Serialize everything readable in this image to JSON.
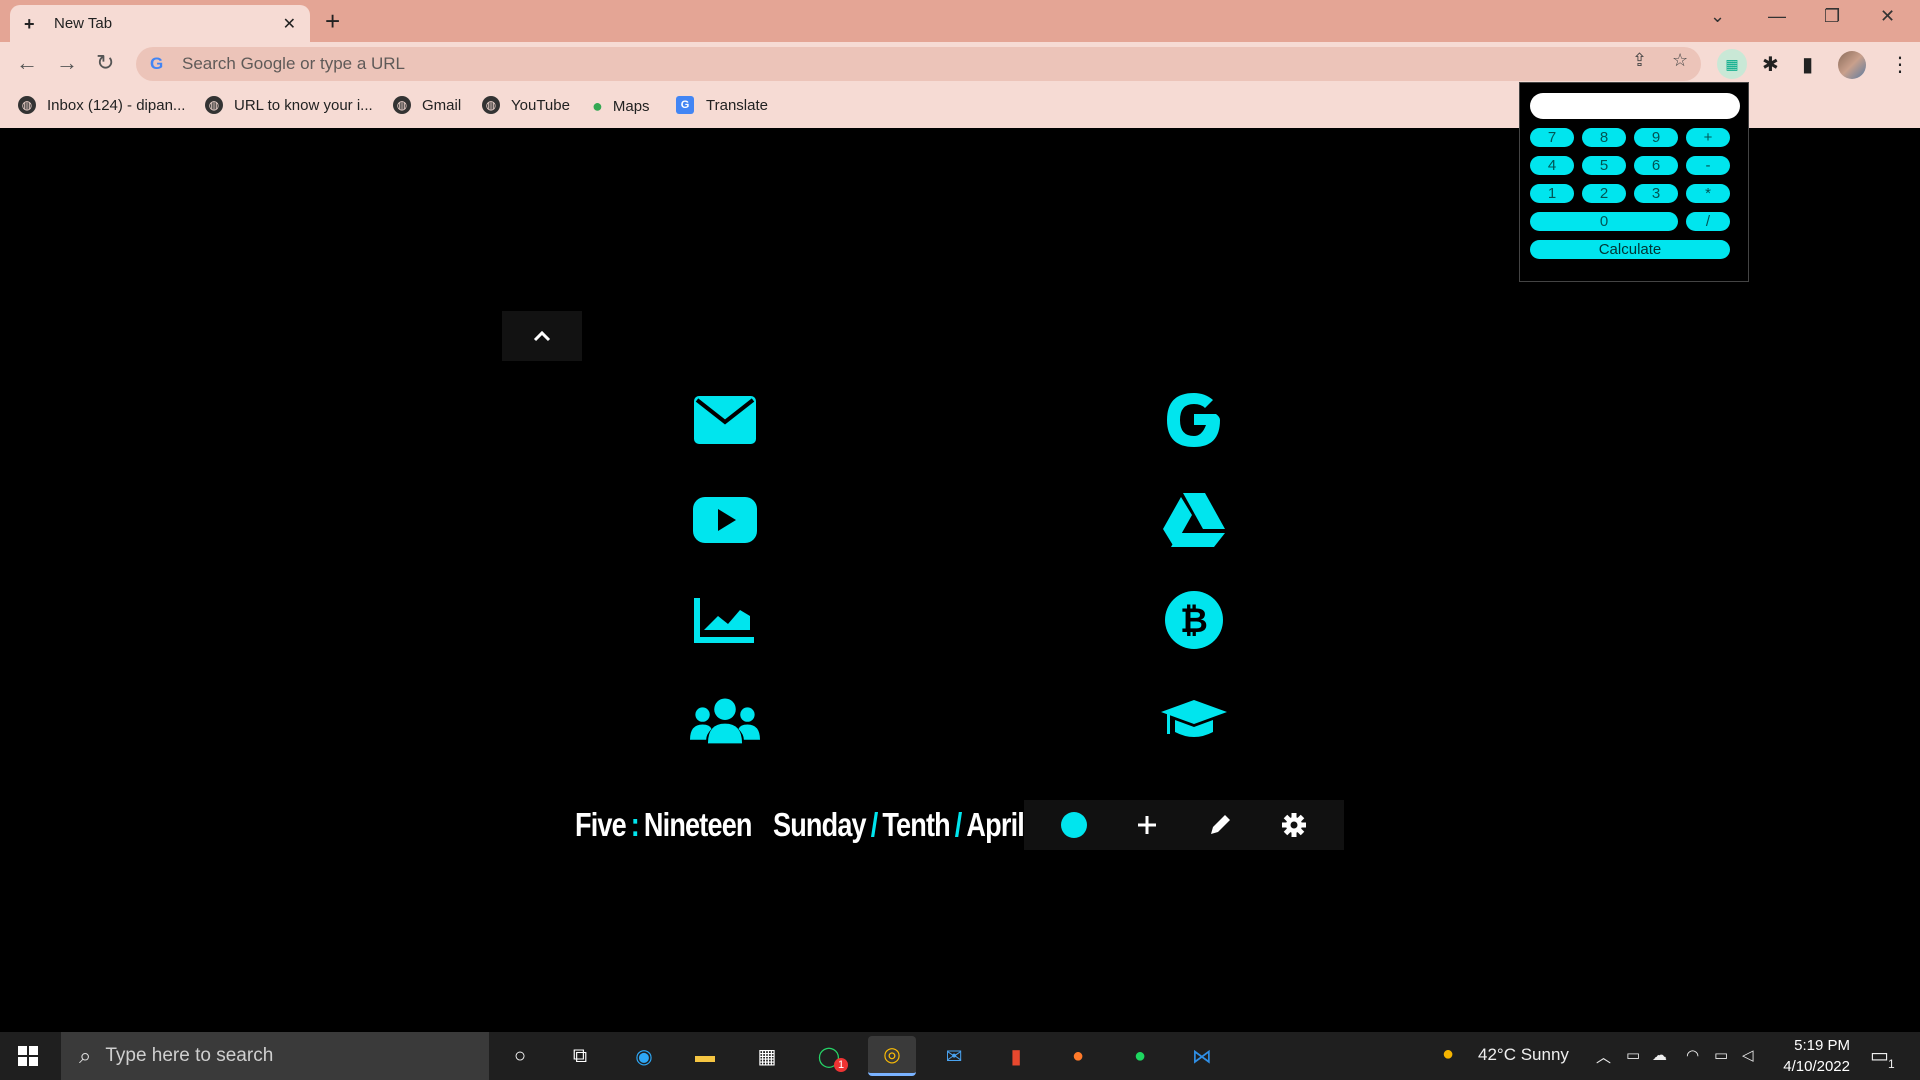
{
  "browser": {
    "tab_title": "New Tab",
    "omnibox_placeholder": "Search Google or type a URL",
    "bookmarks": [
      {
        "label": "Inbox (124) - dipan...",
        "icon": "globe-icon"
      },
      {
        "label": "URL to know your i...",
        "icon": "globe-icon"
      },
      {
        "label": "Gmail",
        "icon": "globe-icon"
      },
      {
        "label": "YouTube",
        "icon": "globe-icon"
      },
      {
        "label": "Maps",
        "icon": "maps-pin-icon"
      },
      {
        "label": "Translate",
        "icon": "translate-icon"
      }
    ],
    "theme_colors": {
      "tabstrip": "#e4a595",
      "toolbar": "#f6dbd4"
    }
  },
  "calculator": {
    "display_value": "",
    "rows": [
      [
        "7",
        "8",
        "9",
        "+"
      ],
      [
        "4",
        "5",
        "6",
        "-"
      ],
      [
        "1",
        "2",
        "3",
        "*"
      ],
      [
        "0",
        "/"
      ]
    ],
    "calculate_label": "Calculate",
    "accent": "#00e5ee"
  },
  "page": {
    "accent": "#00e5ee",
    "shortcuts_left": [
      "envelope-icon",
      "youtube-icon",
      "chart-line-icon",
      "users-icon"
    ],
    "shortcuts_right": [
      "google-icon",
      "google-drive-icon",
      "bitcoin-icon",
      "graduation-cap-icon"
    ],
    "clock": {
      "hours": "Five",
      "time_sep": ":",
      "minutes": "Nineteen",
      "day": "Sunday",
      "date_sep": "/",
      "date": "Tenth",
      "month": "April"
    },
    "controls": [
      "theme-dot-icon",
      "plus-icon",
      "pencil-icon",
      "gear-icon"
    ]
  },
  "taskbar": {
    "search_placeholder": "Type here to search",
    "weather": "42°C  Sunny",
    "time": "5:19 PM",
    "date": "4/10/2022",
    "whatsapp_badge": "1",
    "notification_count": "1"
  }
}
